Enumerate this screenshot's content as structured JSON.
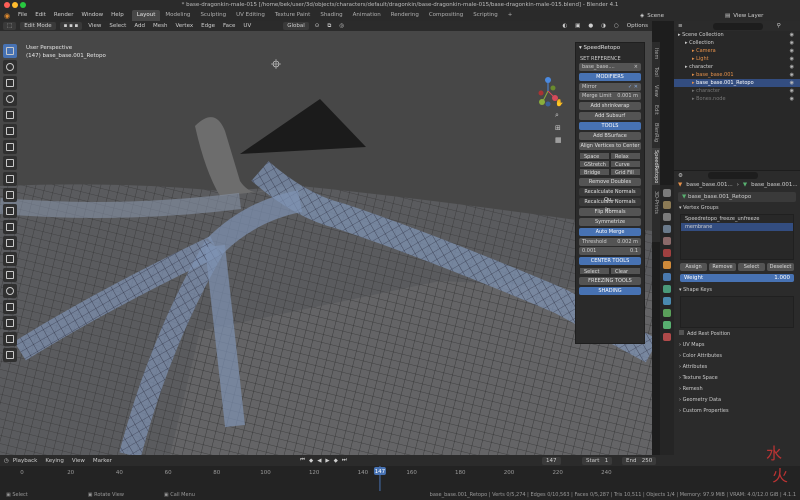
{
  "window": {
    "title": "* base-dragonkin-male-015 [/home/bek/user/3d/objects/characters/default/dragonkin/base-dragonkin-male-015/base-dragonkin-male-015.blend] - Blender 4.1"
  },
  "menu": [
    "File",
    "Edit",
    "Render",
    "Window",
    "Help"
  ],
  "workspaces": [
    "Layout",
    "Modeling",
    "Sculpting",
    "UV Editing",
    "Texture Paint",
    "Shading",
    "Animation",
    "Rendering",
    "Compositing",
    "Scripting"
  ],
  "active_workspace": "Layout",
  "scene": {
    "scene_label": "Scene",
    "view_layer_label": "View Layer"
  },
  "viewport_header": {
    "mode": "Edit Mode",
    "menus": [
      "View",
      "Select",
      "Add",
      "Mesh",
      "Vertex",
      "Edge",
      "Face",
      "UV"
    ],
    "orientation": "Global",
    "options_label": "Options"
  },
  "viewport": {
    "view_name": "User Perspective",
    "object_name": "(147) base_base.001_Retopo"
  },
  "npanel": {
    "title": "SpeedRetopo",
    "set_reference": "SET REFERENCE",
    "reference_obj": "base_base....",
    "modifiers_label": "MODIFIERS",
    "mirror_label": "Mirror",
    "merge_limit_label": "Merge Limit",
    "merge_limit_value": "0.001 m",
    "add_shrinkwrap": "Add shrinkwrap",
    "add_subsurf": "Add Subsurf",
    "tools_label": "TOOLS",
    "add_bsurface": "Add BSurface",
    "align_vertices": "Align Vertices to Center",
    "space": "Space",
    "relax": "Relax",
    "gstretch": "GStretch",
    "curve": "Curve",
    "bridge": "Bridge",
    "grid_fill": "Grid Fill",
    "remove_doubles": "Remove Doubles",
    "recalc_out": "Recalculate Normals Ou...",
    "recalc_in": "Recalculate Normals In...",
    "flip_normals": "Flip Normals",
    "symmetrize": "Symmetrize",
    "auto_merge": "Auto Merge",
    "threshold_label": "Threshold",
    "threshold_value": "0.002 m",
    "val_a": "0.001",
    "val_b": "0.1",
    "center_tools": "CENTER TOOLS",
    "select": "Select",
    "clear": "Clear",
    "freezing_tools": "FREEZING TOOLS",
    "shading": "SHADING"
  },
  "vtabs": [
    "Item",
    "Tool",
    "View",
    "Edit",
    "BlenRig",
    "SpeedRetopo",
    "3D-Prints"
  ],
  "outliner": {
    "search_placeholder": "",
    "items": [
      {
        "label": "Scene Collection",
        "indent": 0,
        "color": "#d0d0d0",
        "selected": false
      },
      {
        "label": "Collection",
        "indent": 1,
        "color": "#d0d0d0",
        "selected": false
      },
      {
        "label": "Camera",
        "indent": 2,
        "color": "#e6914a",
        "selected": false
      },
      {
        "label": "Light",
        "indent": 2,
        "color": "#e6914a",
        "selected": false
      },
      {
        "label": "character",
        "indent": 1,
        "color": "#d0d0d0",
        "selected": false
      },
      {
        "label": "base_base.001",
        "indent": 2,
        "color": "#e6914a",
        "selected": false
      },
      {
        "label": "base_base.001_Retopo",
        "indent": 2,
        "color": "#e6914a",
        "selected": true
      },
      {
        "label": "character",
        "indent": 2,
        "color": "#777777",
        "selected": false
      },
      {
        "label": "Bones.node",
        "indent": 2,
        "color": "#777777",
        "selected": false
      }
    ]
  },
  "props": {
    "obj_name_a": "base_base.001...",
    "obj_name_b": "base_base.001...",
    "mesh_name": "base_base.001_Retopo",
    "vertex_groups_label": "Vertex Groups",
    "vertex_groups": [
      {
        "label": "Speedretopo_freeze_unfreeze",
        "selected": false
      },
      {
        "label": "membrane",
        "selected": true
      }
    ],
    "assign": "Assign",
    "remove": "Remove",
    "select": "Select",
    "deselect": "Deselect",
    "weight_label": "Weight",
    "weight_value": "1.000",
    "shape_keys_label": "Shape Keys",
    "add_rest_position": "Add Rest Position",
    "sections": [
      "UV Maps",
      "Color Attributes",
      "Attributes",
      "Texture Space",
      "Remesh",
      "Geometry Data",
      "Custom Properties"
    ]
  },
  "timeline": {
    "menus": [
      "Playback",
      "Keying",
      "View",
      "Marker"
    ],
    "current_frame": "147",
    "start_label": "Start",
    "start_value": "1",
    "end_label": "End",
    "end_value": "250",
    "ticks": [
      "0",
      "20",
      "40",
      "60",
      "80",
      "100",
      "120",
      "140",
      "160",
      "180",
      "200",
      "220",
      "240"
    ]
  },
  "status": {
    "select": "Select",
    "rotate_view": "Rotate View",
    "call_menu": "Call Menu",
    "info": "base_base.001_Retopo | Verts 0/5,274 | Edges 0/10,563 | Faces 0/5,287 | Tris 10,511 | Objects 1/4 | Memory: 97.9 MiB | VRAM: 4.0/12.0 GiB | 4.1.1"
  },
  "colors": {
    "accent": "#4772b3",
    "selection": "#334d80",
    "orange": "#e6914a"
  }
}
